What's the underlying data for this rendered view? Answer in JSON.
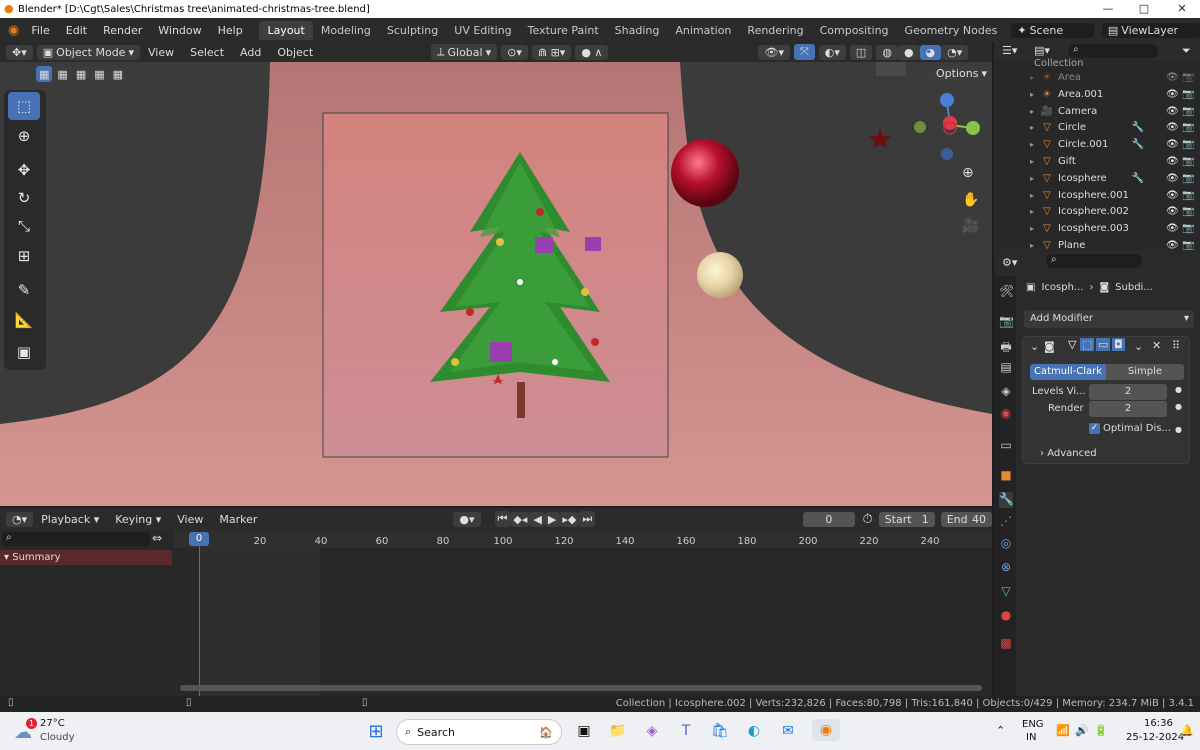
{
  "window": {
    "title": "Blender* [D:\\Cgt\\Sales\\Christmas tree\\animated-christmas-tree.blend]"
  },
  "menu": [
    "File",
    "Edit",
    "Render",
    "Window",
    "Help"
  ],
  "workspaces": [
    "Layout",
    "Modeling",
    "Sculpting",
    "UV Editing",
    "Texture Paint",
    "Shading",
    "Animation",
    "Rendering",
    "Compositing",
    "Geometry Nodes"
  ],
  "scene": {
    "label": "Scene",
    "view_layer": "ViewLayer"
  },
  "viewport_header": {
    "mode": "Object Mode",
    "view": "View",
    "select": "Select",
    "add": "Add",
    "object": "Object",
    "transform": "Global",
    "options": "Options"
  },
  "outliner": {
    "collection": "Collection",
    "rows": [
      {
        "name": "Area",
        "icon": "light-icon",
        "dim": true
      },
      {
        "name": "Area.001",
        "icon": "light-icon"
      },
      {
        "name": "Camera",
        "icon": "camera-icon"
      },
      {
        "name": "Circle",
        "icon": "mesh-icon"
      },
      {
        "name": "Circle.001",
        "icon": "mesh-icon"
      },
      {
        "name": "Gift",
        "icon": "mesh-icon"
      },
      {
        "name": "Icosphere",
        "icon": "mesh-icon"
      },
      {
        "name": "Icosphere.001",
        "icon": "mesh-icon"
      },
      {
        "name": "Icosphere.002",
        "icon": "mesh-icon"
      },
      {
        "name": "Icosphere.003",
        "icon": "mesh-icon"
      },
      {
        "name": "Plane",
        "icon": "mesh-icon"
      }
    ]
  },
  "properties": {
    "breadcrumb_object": "Icosph...",
    "breadcrumb_modifier": "Subdi...",
    "add_modifier": "Add Modifier",
    "catmull": "Catmull-Clark",
    "simple": "Simple",
    "levels_label": "Levels Vi...",
    "levels_value": "2",
    "render_label": "Render",
    "render_value": "2",
    "optimal": "Optimal Dis...",
    "advanced": "Advanced"
  },
  "timeline": {
    "playback": "Playback",
    "keying": "Keying",
    "view": "View",
    "marker": "Marker",
    "current_frame": "0",
    "start_label": "Start",
    "start": "1",
    "end_label": "End",
    "end": "40",
    "summary": "Summary",
    "ticks": [
      "0",
      "20",
      "40",
      "60",
      "80",
      "100",
      "120",
      "140",
      "160",
      "180",
      "200",
      "220",
      "240"
    ]
  },
  "status": {
    "text": "Collection | Icosphere.002 | Verts:232,826 | Faces:80,798 | Tris:161,840 | Objects:0/429 | Memory: 234.7 MiB | 3.4.1"
  },
  "taskbar": {
    "weather_temp": "27°C",
    "weather_desc": "Cloudy",
    "weather_badge": "1",
    "search": "Search",
    "lang": "ENG",
    "region": "IN",
    "time": "16:36",
    "date": "25-12-2024"
  },
  "colors": {
    "accent": "#4772b3",
    "wall": "#d58b87",
    "backdrop": "#c9a5a5"
  }
}
